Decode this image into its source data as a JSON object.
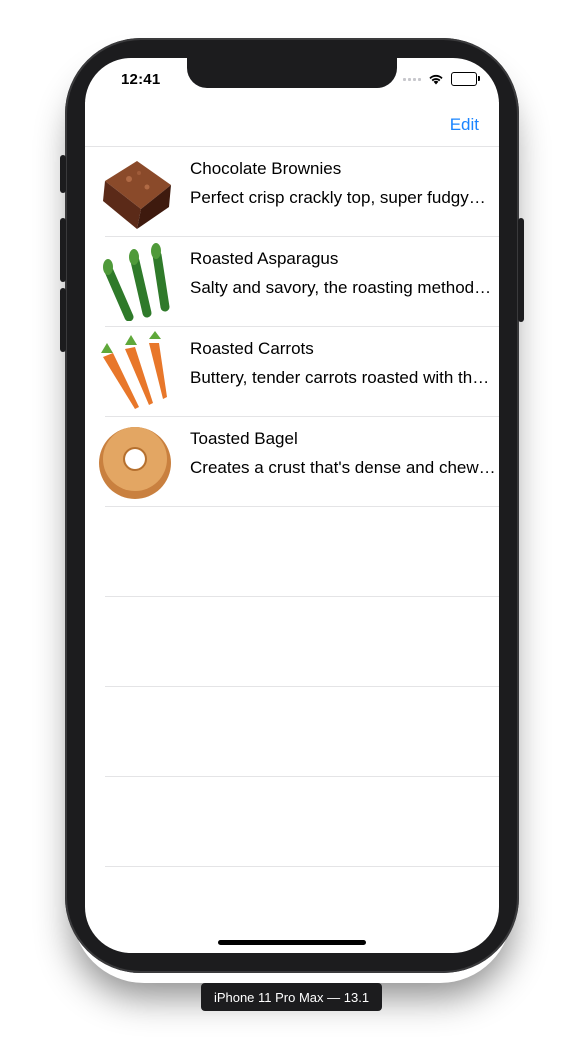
{
  "status_bar": {
    "time": "12:41"
  },
  "nav": {
    "edit_label": "Edit",
    "accent_color": "#1a84ff"
  },
  "recipes": [
    {
      "title": "Chocolate Brownies",
      "subtitle": "Perfect crisp crackly top, super fudgy…",
      "icon": "brownie-icon"
    },
    {
      "title": "Roasted Asparagus",
      "subtitle": "Salty and savory, the roasting method…",
      "icon": "asparagus-icon"
    },
    {
      "title": "Roasted Carrots",
      "subtitle": "Buttery, tender carrots roasted with th…",
      "icon": "carrot-icon"
    },
    {
      "title": "Toasted Bagel",
      "subtitle": "Creates a crust that's dense and chew…",
      "icon": "bagel-icon"
    }
  ],
  "device_label": "iPhone 11 Pro Max — 13.1"
}
